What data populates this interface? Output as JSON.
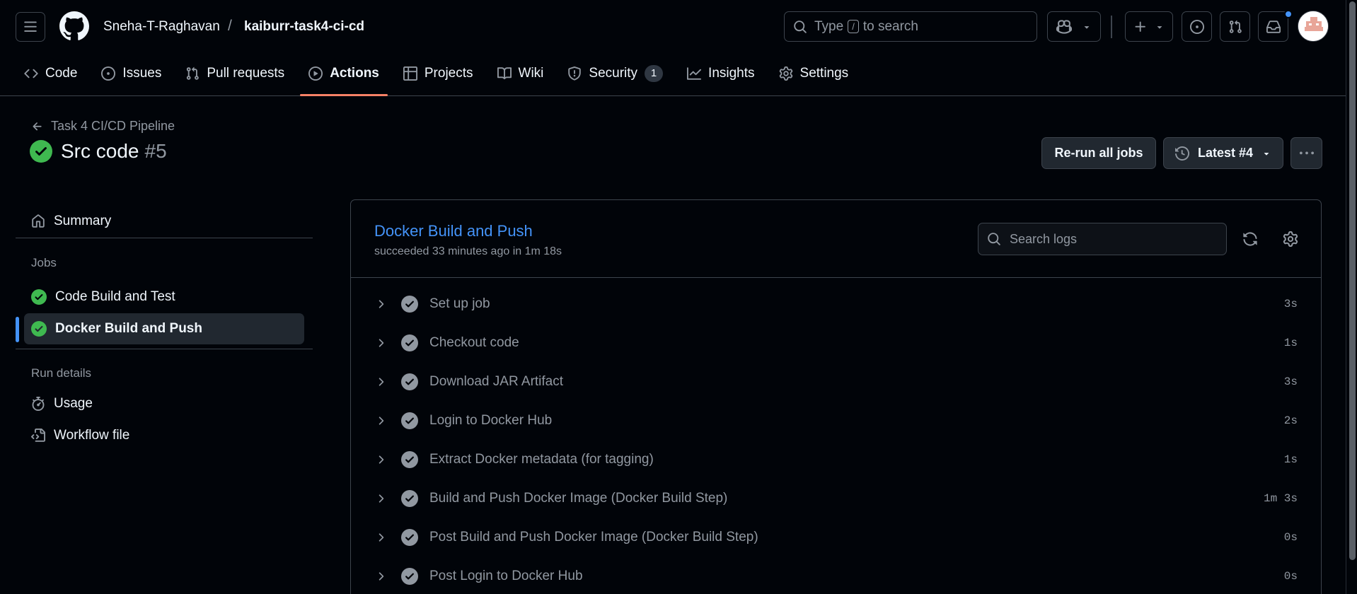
{
  "header": {
    "owner": "Sneha-T-Raghavan",
    "separator": "/",
    "repo": "kaiburr-task4-ci-cd",
    "search_prefix": "Type",
    "search_key": "/",
    "search_suffix": "to search"
  },
  "tabs": [
    {
      "label": "Code",
      "icon": "code-icon"
    },
    {
      "label": "Issues",
      "icon": "issue-icon"
    },
    {
      "label": "Pull requests",
      "icon": "pull-request-icon"
    },
    {
      "label": "Actions",
      "icon": "play-icon",
      "active": true
    },
    {
      "label": "Projects",
      "icon": "table-icon"
    },
    {
      "label": "Wiki",
      "icon": "book-icon"
    },
    {
      "label": "Security",
      "icon": "shield-icon",
      "counter": "1"
    },
    {
      "label": "Insights",
      "icon": "graph-icon"
    },
    {
      "label": "Settings",
      "icon": "gear-icon"
    }
  ],
  "run": {
    "back_label": "Task 4 CI/CD Pipeline",
    "title": "Src code",
    "number": "#5",
    "rerun_label": "Re-run all jobs",
    "attempt_label": "Latest #4"
  },
  "sidebar": {
    "summary_label": "Summary",
    "jobs_heading": "Jobs",
    "jobs": [
      {
        "label": "Code Build and Test",
        "status": "success"
      },
      {
        "label": "Docker Build and Push",
        "status": "success",
        "selected": true
      }
    ],
    "run_details_heading": "Run details",
    "usage_label": "Usage",
    "workflow_label": "Workflow file"
  },
  "job": {
    "title": "Docker Build and Push",
    "subtitle": "succeeded 33 minutes ago in 1m 18s",
    "search_placeholder": "Search logs",
    "steps": [
      {
        "label": "Set up job",
        "duration": "3s"
      },
      {
        "label": "Checkout code",
        "duration": "1s"
      },
      {
        "label": "Download JAR Artifact",
        "duration": "3s"
      },
      {
        "label": "Login to Docker Hub",
        "duration": "2s"
      },
      {
        "label": "Extract Docker metadata (for tagging)",
        "duration": "1s"
      },
      {
        "label": "Build and Push Docker Image (Docker Build Step)",
        "duration": "1m 3s"
      },
      {
        "label": "Post Build and Push Docker Image (Docker Build Step)",
        "duration": "0s"
      },
      {
        "label": "Post Login to Docker Hub",
        "duration": "0s"
      }
    ]
  },
  "colors": {
    "background": "#010409",
    "accent_blue": "#4493f8",
    "success_green": "#3fb950",
    "tab_underline": "#f78166",
    "border": "#3d444d"
  }
}
